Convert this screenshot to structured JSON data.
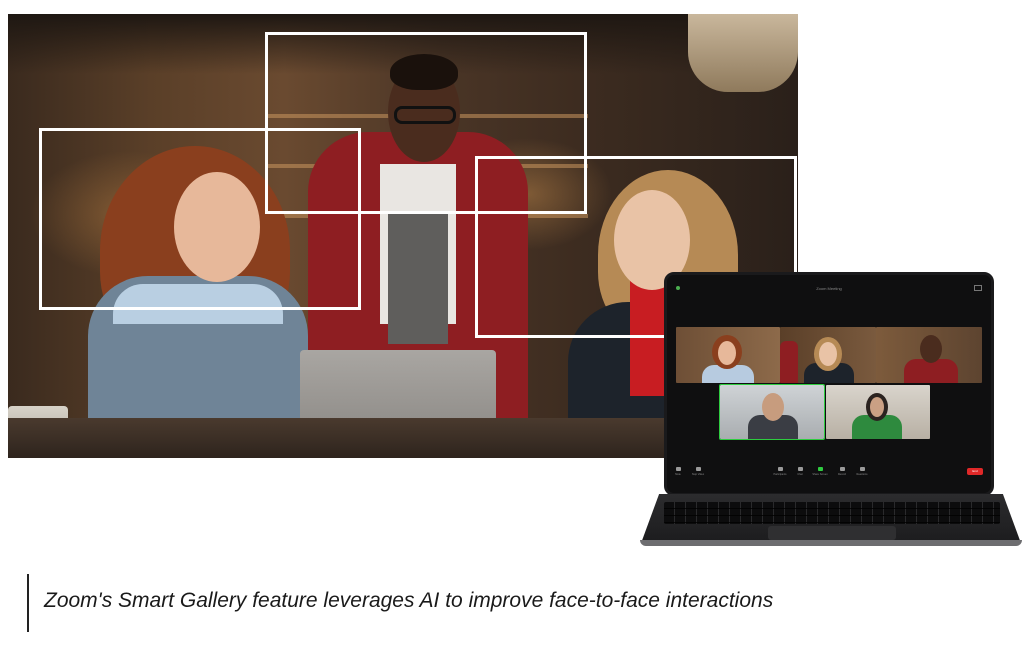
{
  "meeting": {
    "window_title": "Zoom Meeting",
    "end_label": "End",
    "toolbar": [
      {
        "label": "Mute",
        "icon": "microphone-icon",
        "active": false
      },
      {
        "label": "Stop Video",
        "icon": "camera-icon",
        "active": false
      },
      {
        "label": "Participants",
        "icon": "participants-icon",
        "active": false
      },
      {
        "label": "Chat",
        "icon": "chat-icon",
        "active": false
      },
      {
        "label": "Share Screen",
        "icon": "share-screen-icon",
        "active": true
      },
      {
        "label": "Record",
        "icon": "record-icon",
        "active": false
      },
      {
        "label": "Reactions",
        "icon": "reactions-icon",
        "active": false
      }
    ]
  },
  "colors": {
    "frame": "#ffffff",
    "active_speaker": "#2ecc40",
    "end_button": "#e02828"
  },
  "caption": {
    "text": "Zoom's Smart Gallery feature leverages AI to improve face-to-face interactions"
  }
}
